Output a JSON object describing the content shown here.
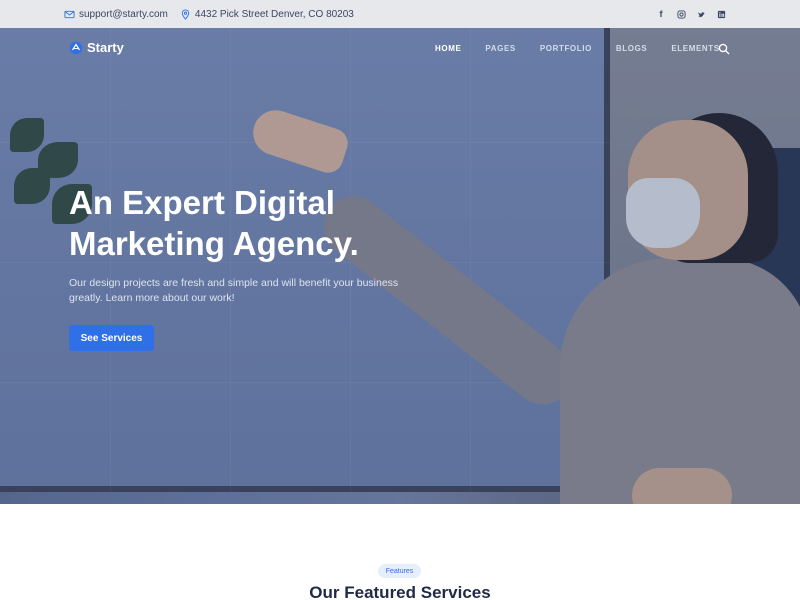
{
  "topbar": {
    "email": "support@starty.com",
    "address": "4432 Pick Street Denver, CO 80203",
    "social_icons": [
      "facebook-icon",
      "instagram-icon",
      "twitter-icon",
      "linkedin-icon"
    ]
  },
  "nav": {
    "logo_text": "Starty",
    "items": [
      "HOME",
      "PAGES",
      "PORTFOLIO",
      "BLOGS",
      "ELEMENTS"
    ],
    "active_item": "HOME",
    "search_icon": "search-icon"
  },
  "hero": {
    "headline_line1": "An Expert Digital",
    "headline_line2": "Marketing Agency.",
    "subtext": "Our design projects are fresh and simple and will benefit your business greatly. Learn more about our work!",
    "cta_label": "See Services"
  },
  "features": {
    "badge": "Features",
    "title": "Our Featured Services"
  },
  "colors": {
    "accent": "#2f6fe8",
    "topbar_bg": "#e6e8ec",
    "heading_dark": "#1f2a44"
  }
}
